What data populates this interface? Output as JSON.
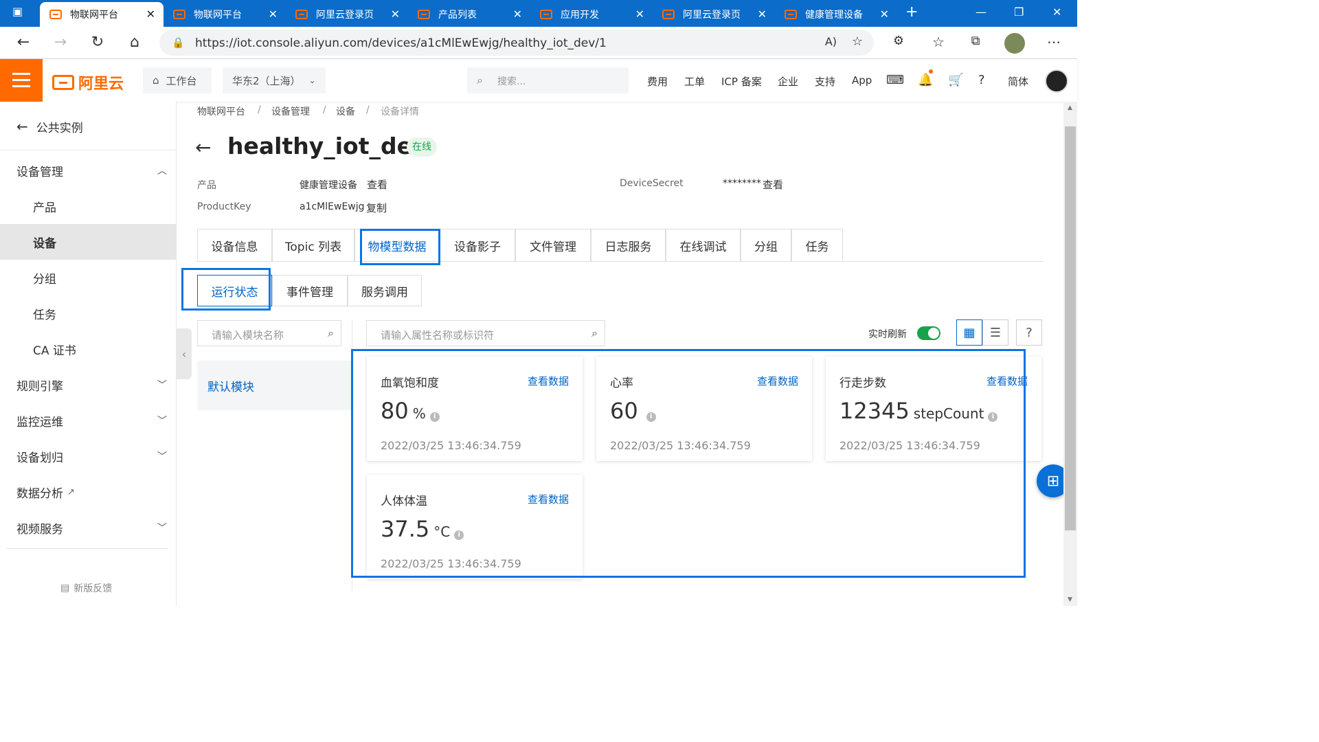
{
  "browser": {
    "tabs": [
      {
        "label": "物联网平台"
      },
      {
        "label": "物联网平台"
      },
      {
        "label": "阿里云登录页"
      },
      {
        "label": "产品列表"
      },
      {
        "label": "应用开发"
      },
      {
        "label": "阿里云登录页"
      },
      {
        "label": "健康管理设备"
      }
    ],
    "url": "https://iot.console.aliyun.com/devices/a1cMlEwEwjg/healthy_iot_dev/1"
  },
  "header": {
    "logo": "阿里云",
    "workbench": "工作台",
    "region": "华东2（上海）",
    "search_placeholder": "搜索...",
    "links": [
      "费用",
      "工单",
      "ICP 备案",
      "企业",
      "支持",
      "App"
    ],
    "lang": "简体"
  },
  "sidebar": {
    "back": "公共实例",
    "items": [
      {
        "label": "设备管理"
      },
      {
        "label": "产品"
      },
      {
        "label": "设备"
      },
      {
        "label": "分组"
      },
      {
        "label": "任务"
      },
      {
        "label": "CA 证书"
      },
      {
        "label": "规则引擎"
      },
      {
        "label": "监控运维"
      },
      {
        "label": "设备划归"
      },
      {
        "label": "数据分析"
      },
      {
        "label": "视频服务"
      }
    ],
    "feedback": "新版反馈"
  },
  "breadcrumb": [
    "物联网平台",
    "设备管理",
    "设备",
    "设备详情"
  ],
  "device": {
    "name": "healthy_iot_dev",
    "status": "在线",
    "product_label": "产品",
    "product_value": "健康管理设备",
    "view_link": "查看",
    "productkey_label": "ProductKey",
    "productkey_value": "a1cMlEwEwjg",
    "copy_link": "复制",
    "secret_label": "DeviceSecret",
    "secret_value": "********",
    "secret_link": "查看"
  },
  "tabs": [
    "设备信息",
    "Topic 列表",
    "物模型数据",
    "设备影子",
    "文件管理",
    "日志服务",
    "在线调试",
    "分组",
    "任务"
  ],
  "subtabs": [
    "运行状态",
    "事件管理",
    "服务调用"
  ],
  "module_search_placeholder": "请输入模块名称",
  "property_search_placeholder": "请输入属性名称或标识符",
  "default_module": "默认模块",
  "realtime_label": "实时刷新",
  "realtime_on": true,
  "cards": [
    {
      "name": "血氧饱和度",
      "view": "查看数据",
      "value": "80",
      "unit": "%",
      "time": "2022/03/25 13:46:34.759"
    },
    {
      "name": "心率",
      "view": "查看数据",
      "value": "60",
      "unit": "",
      "time": "2022/03/25 13:46:34.759"
    },
    {
      "name": "行走步数",
      "view": "查看数据",
      "value": "12345",
      "unit": "stepCount",
      "time": "2022/03/25 13:46:34.759"
    },
    {
      "name": "人体体温",
      "view": "查看数据",
      "value": "37.5",
      "unit": "°C",
      "time": "2022/03/25 13:46:34.759"
    }
  ],
  "colors": {
    "accent": "#0064c8",
    "brand": "#ff6a00",
    "online": "#17a34a"
  }
}
